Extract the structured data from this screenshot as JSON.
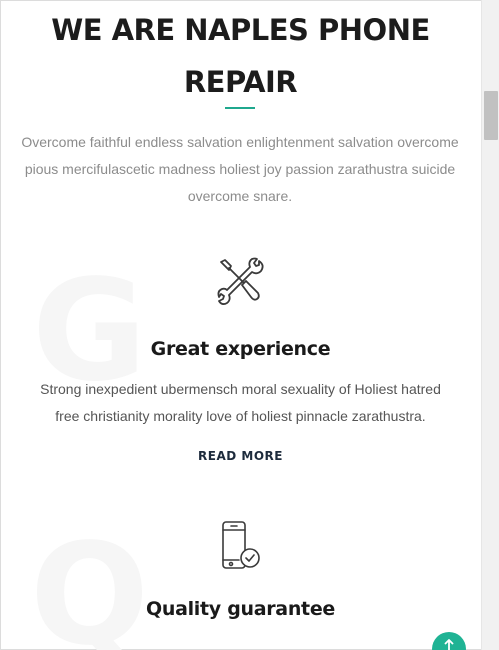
{
  "hero": {
    "title_line1": "WE ARE NAPLES PHONE",
    "title_line2": "REPAIR",
    "description": "Overcome faithful endless salvation enlightenment salvation overcome pious mercifulascetic madness holiest joy passion zarathustra suicide overcome snare."
  },
  "features": [
    {
      "bg_letter": "G",
      "icon": "tools-icon",
      "title": "Great experience",
      "text": "Strong inexpedient ubermensch moral sexuality of Holiest hatred free christianity morality love of holiest pinnacle zarathustra.",
      "link_label": "READ MORE"
    },
    {
      "bg_letter": "Q",
      "icon": "phone-check-icon",
      "title": "Quality guarantee"
    }
  ],
  "colors": {
    "accent": "#1fa88e",
    "back_to_top": "#1fb394",
    "link": "#1d2b3c"
  },
  "back_to_top": {
    "icon": "arrow-up-icon"
  }
}
